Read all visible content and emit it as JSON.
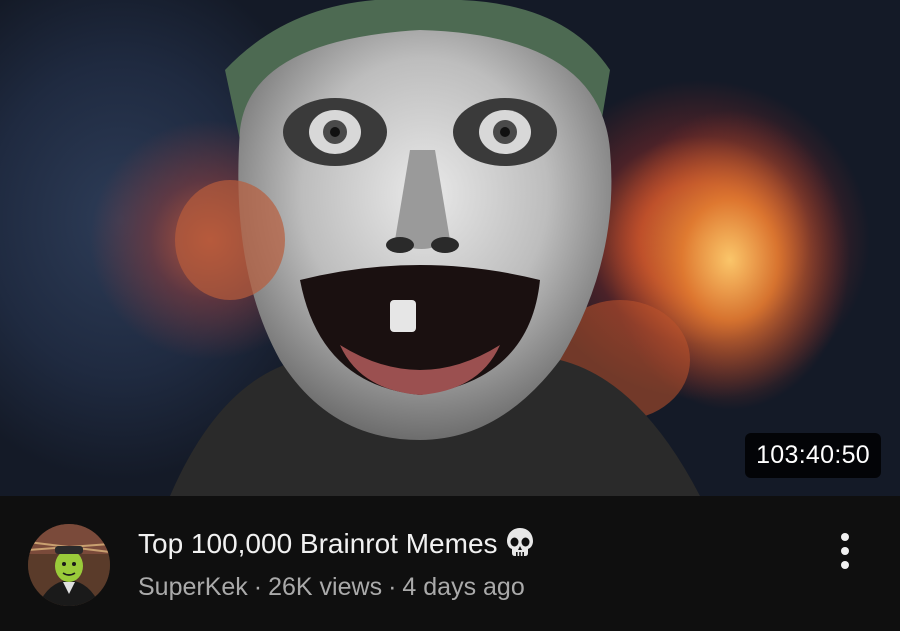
{
  "video": {
    "title": "Top 100,000 Brainrot Memes",
    "title_emoji": "skull-icon",
    "duration": "103:40:50",
    "channel": "SuperKek",
    "separator": "·",
    "views": "26K views",
    "published": "4 days ago"
  },
  "icons": {
    "avatar": "channel-avatar",
    "more": "more-vert-icon"
  },
  "colors": {
    "background": "#0f0f0f",
    "title_text": "#f1f1f1",
    "meta_text": "#aaaaaa",
    "badge_bg": "#000000"
  }
}
